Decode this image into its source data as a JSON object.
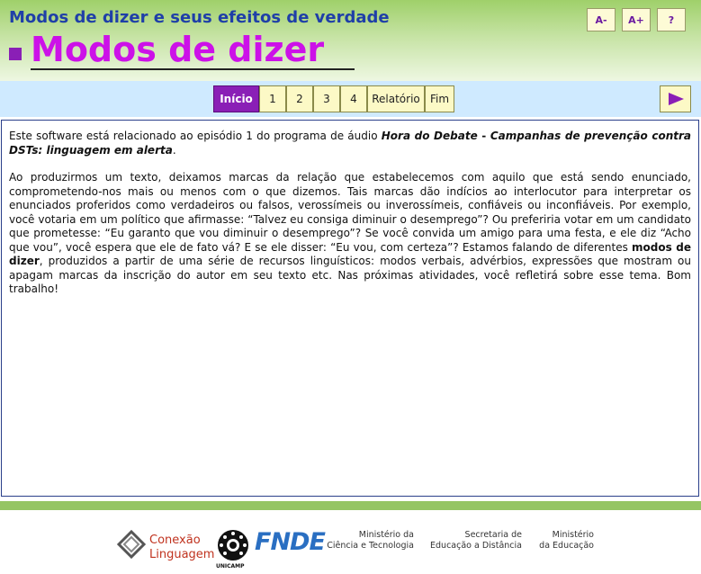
{
  "header": {
    "app_title": "Modos de dizer e seus efeitos de verdade",
    "page_heading": "Modos de dizer",
    "tools": [
      "A-",
      "A+",
      "?"
    ]
  },
  "nav": {
    "items": [
      "Início",
      "1",
      "2",
      "3",
      "4",
      "Relatório",
      "Fim"
    ],
    "active": "Início",
    "next_icon": "arrow-right-icon"
  },
  "content": {
    "intro_prefix": "Este software está relacionado ao episódio 1 do programa de áudio ",
    "intro_program": "Hora do Debate",
    "intro_sep": " - ",
    "intro_episode": "Campanhas de prevenção contra DSTs: linguagem em alerta",
    "intro_suffix": ".",
    "body_part1": "Ao produzirmos um texto, deixamos marcas da relação que estabelecemos com aquilo que está sendo enunciado, comprometendo-nos mais ou menos com o que dizemos. Tais marcas dão indícios ao interlocutor para interpretar os enunciados proferidos como verdadeiros ou falsos, verossímeis ou inverossímeis, confiáveis ou inconfiáveis. Por exemplo, você votaria em um político que afirmasse: “Talvez eu consiga diminuir o desemprego”? Ou preferiria votar em um candidato que prometesse: “Eu garanto que vou diminuir o desemprego”? Se você convida um amigo para uma festa, e ele diz “Acho que vou”, você espera que ele de fato vá? E se ele disser: “Eu vou, com certeza”? Estamos falando de diferentes ",
    "body_bold": "modos de dizer",
    "body_part2": ", produzidos a partir de uma série de recursos linguísticos: modos verbais, advérbios, expressões que mostram ou apagam marcas da inscrição do autor em seu texto etc. Nas próximas atividades, você refletirá sobre esse tema. Bom trabalho!"
  },
  "footer": {
    "conexao_line1": "Conexão",
    "conexao_line2": "Linguagem",
    "unicamp": "UNICAMP",
    "fnde": "FNDE",
    "ministry1_line1": "Ministério da",
    "ministry1_line2": "Ciência e Tecnologia",
    "ministry2_line1": "Secretaria de",
    "ministry2_line2": "Educação a Distância",
    "ministry3_line1": "Ministério",
    "ministry3_line2": "da Educação"
  },
  "colors": {
    "accent_purple": "#8a1fb6",
    "heading_magenta": "#cc11e8",
    "title_blue": "#1f3fa8",
    "nav_bg": "#cfeaff",
    "header_green": "#9fd06a"
  }
}
